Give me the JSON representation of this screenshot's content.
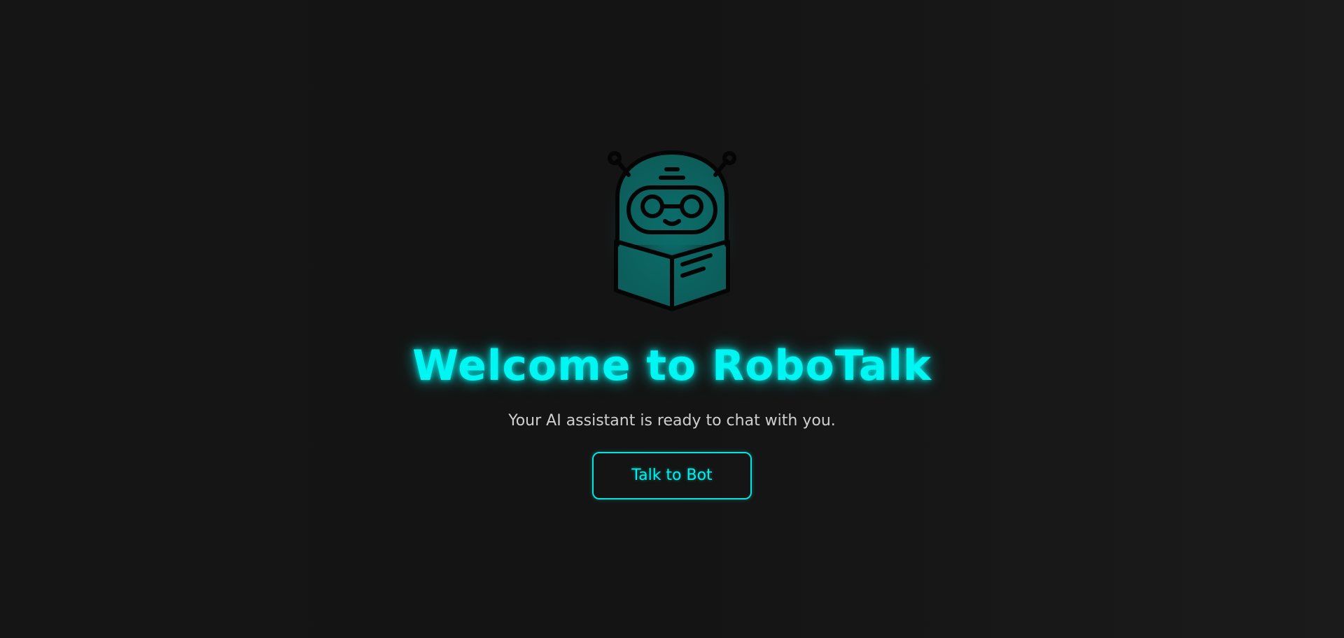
{
  "hero": {
    "icon": "robot-reading-book-icon",
    "title": "Welcome to RoboTalk",
    "subtitle": "Your AI assistant is ready to chat with you.",
    "cta_label": "Talk to Bot"
  },
  "colors": {
    "accent": "#00f6f2",
    "background": "#151515",
    "subtitle_text": "#cfcfcf"
  }
}
